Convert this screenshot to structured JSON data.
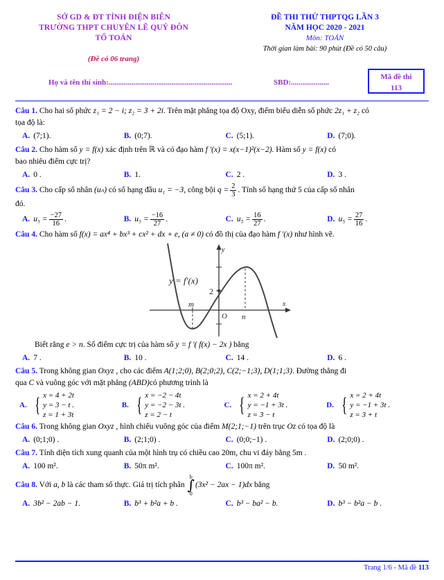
{
  "header": {
    "school_lines": [
      "SỞ GD & ĐT TỈNH ĐIỆN BIÊN",
      "TRƯỜNG THPT CHUYÊN LÊ QUÝ ĐÔN",
      "TỔ TOÁN"
    ],
    "pages_note": "(Đề có 06 trang)",
    "exam_title_line1": "ĐỀ THI THỬ THPTQG LẦN 3",
    "exam_title_line2": "NĂM HỌC 2020 - 2021",
    "subject": "Môn: TOÁN",
    "duration": "Thời gian làm bài: 90 phút (Đề có 50 câu)",
    "name_field": "Họ và tên thí sinh:.................................................................",
    "sbd_field": "SBD:....................",
    "code_label": "Mã đề thi",
    "code_value": "113"
  },
  "colors": {
    "heading_purple": "#9a2fd0",
    "accent_blue": "#1a1aff",
    "note_red": "#c2185b"
  },
  "questions": [
    {
      "id": "q1",
      "label": "Câu 1.",
      "text_line1_a": "Cho hai số phức ",
      "text_line1_b": ". Trên mặt phẳng tọa độ Oxy, điểm biểu diễn số phức ",
      "text_line1_c": " có",
      "text_line2": "tọa độ là:",
      "math_z1": "z₁ = 2 − i; z₂ = 3 + 2i",
      "math_expr": "2z₁ + z₂",
      "options": [
        {
          "letter": "A.",
          "value": "(7;1)."
        },
        {
          "letter": "B.",
          "value": "(0;7)."
        },
        {
          "letter": "C.",
          "value": "(5;1)."
        },
        {
          "letter": "D.",
          "value": "(7;0)."
        }
      ]
    },
    {
      "id": "q2",
      "label": "Câu 2.",
      "text_a": "Cho hàm số ",
      "fx": "y = f(x)",
      "text_b": " xác định trên ",
      "rset": "ℝ",
      "text_c": " và có đạo hàm ",
      "deriv": "f '(x) = x(x−1)²(x−2)",
      "text_d": ". Hàm số ",
      "fx2": "y = f(x)",
      "text_e": " có",
      "text_line2": "bao nhiêu điểm cực trị?",
      "options": [
        {
          "letter": "A.",
          "value": "0 ."
        },
        {
          "letter": "B.",
          "value": "1."
        },
        {
          "letter": "C.",
          "value": "2 ."
        },
        {
          "letter": "D.",
          "value": "3 ."
        }
      ]
    },
    {
      "id": "q3",
      "label": "Câu 3.",
      "text_a": "Cho cấp số nhân ",
      "seq": "(uₙ)",
      "text_b": " có số hạng đầu ",
      "u1": "u₁ = −3",
      "text_c": ", công bội ",
      "q_num": "2",
      "q_den": "3",
      "text_d": ". Tính số hạng thứ 5 của cấp số nhân",
      "text_line2": "đó.",
      "options": [
        {
          "letter": "A.",
          "num": "−27",
          "den": "16",
          "suffix": "."
        },
        {
          "letter": "B.",
          "num": "−16",
          "den": "27",
          "suffix": "."
        },
        {
          "letter": "C.",
          "num": "16",
          "den": "27",
          "suffix": "."
        },
        {
          "letter": "D.",
          "num": "27",
          "den": "16",
          "suffix": "."
        }
      ],
      "opt_lhs": "u₅ ="
    },
    {
      "id": "q4",
      "label": "Câu 4.",
      "text_a": "Cho hàm số ",
      "func": "f(x) = ax⁴ + bx³ + cx² + dx + e, (a ≠ 0)",
      "text_b": " có đồ thị của đạo hàm ",
      "deriv": "f '(x)",
      "text_c": " như hình vẽ.",
      "after_graph_a": "Biết rằng ",
      "cond": "e > n",
      "after_graph_b": ". Số điểm cực trị của hàm số ",
      "composite": "y = f '( f(x) − 2x )",
      "after_graph_c": " bằng",
      "options": [
        {
          "letter": "A.",
          "value": "7 ."
        },
        {
          "letter": "B.",
          "value": "10 ."
        },
        {
          "letter": "C.",
          "value": "14 ."
        },
        {
          "letter": "D.",
          "value": "6 ."
        }
      ]
    },
    {
      "id": "q5",
      "label": "Câu 5.",
      "text_a": "Trong không gian ",
      "space": "Oxyz",
      "text_b": " , cho các điểm ",
      "points": "A(1;2;0), B(2;0;2), C(2;−1;3), D(1;1;3)",
      "text_c": ". Đường thẳng đi",
      "text_line2_a": "qua ",
      "pointC": "C",
      "text_line2_b": " và vuông góc với mặt phẳng ",
      "plane": "(ABD)",
      "text_line2_c": "có phương trình là",
      "options": [
        {
          "letter": "A.",
          "lines": [
            "x = 4 + 2t",
            "y = 3 − t  .",
            "z = 1 + 3t"
          ]
        },
        {
          "letter": "B.",
          "lines": [
            "x = −2 − 4t",
            "y = −2 − 3t .",
            "z = 2 − t"
          ]
        },
        {
          "letter": "C.",
          "lines": [
            "x = 2 + 4t",
            "y = −1 + 3t .",
            "z = 3 − t"
          ]
        },
        {
          "letter": "D.",
          "lines": [
            "x = 2 + 4t",
            "y = −1 + 3t .",
            "z = 3 + t"
          ]
        }
      ]
    },
    {
      "id": "q6",
      "label": "Câu 6.",
      "text_a": "Trong không gian ",
      "space": "Oxyz",
      "text_b": " , hình chiếu vuông góc của điểm ",
      "pointM": "M(2;1;−1)",
      "text_c": " trên trục ",
      "axis": "Oz",
      "text_d": " có tọa độ là",
      "options": [
        {
          "letter": "A.",
          "value": "(0;1;0) ."
        },
        {
          "letter": "B.",
          "value": "(2;1;0) ."
        },
        {
          "letter": "C.",
          "value": "(0;0;−1) ."
        },
        {
          "letter": "D.",
          "value": "(2;0;0) ."
        }
      ]
    },
    {
      "id": "q7",
      "label": "Câu 7.",
      "text": "Tính diện tích xung quanh của một hình trụ có chiều cao 20m, chu vi đáy bằng 5m .",
      "options": [
        {
          "letter": "A.",
          "value": "100 m²."
        },
        {
          "letter": "B.",
          "value": "50π m²."
        },
        {
          "letter": "C.",
          "value": "100π m²."
        },
        {
          "letter": "D.",
          "value": "50 m²."
        }
      ]
    },
    {
      "id": "q8",
      "label": "Câu 8.",
      "text_a": "Với ",
      "params": "a, b",
      "text_b": " là các tham số thực. Giá trị tích phân ",
      "integral_upper": "b",
      "integral_lower": "0",
      "integrand": "(3x² − 2ax − 1)dx",
      "text_c": " bằng",
      "options": [
        {
          "letter": "A.",
          "value": "3b² − 2ab − 1."
        },
        {
          "letter": "B.",
          "value": "b³ + b²a + b ."
        },
        {
          "letter": "C.",
          "value": "b³ − ba² − b."
        },
        {
          "letter": "D.",
          "value": "b³ − b²a − b ."
        }
      ]
    }
  ],
  "graph": {
    "curve_label": "y = f′(x)",
    "y_tick_label": "2",
    "x_label": "x",
    "y_label": "y",
    "origin_label": "O",
    "point_m": "m",
    "point_n": "n"
  },
  "footer": {
    "text_prefix": "Trang 1/6 - Mã đề ",
    "code": "113"
  }
}
